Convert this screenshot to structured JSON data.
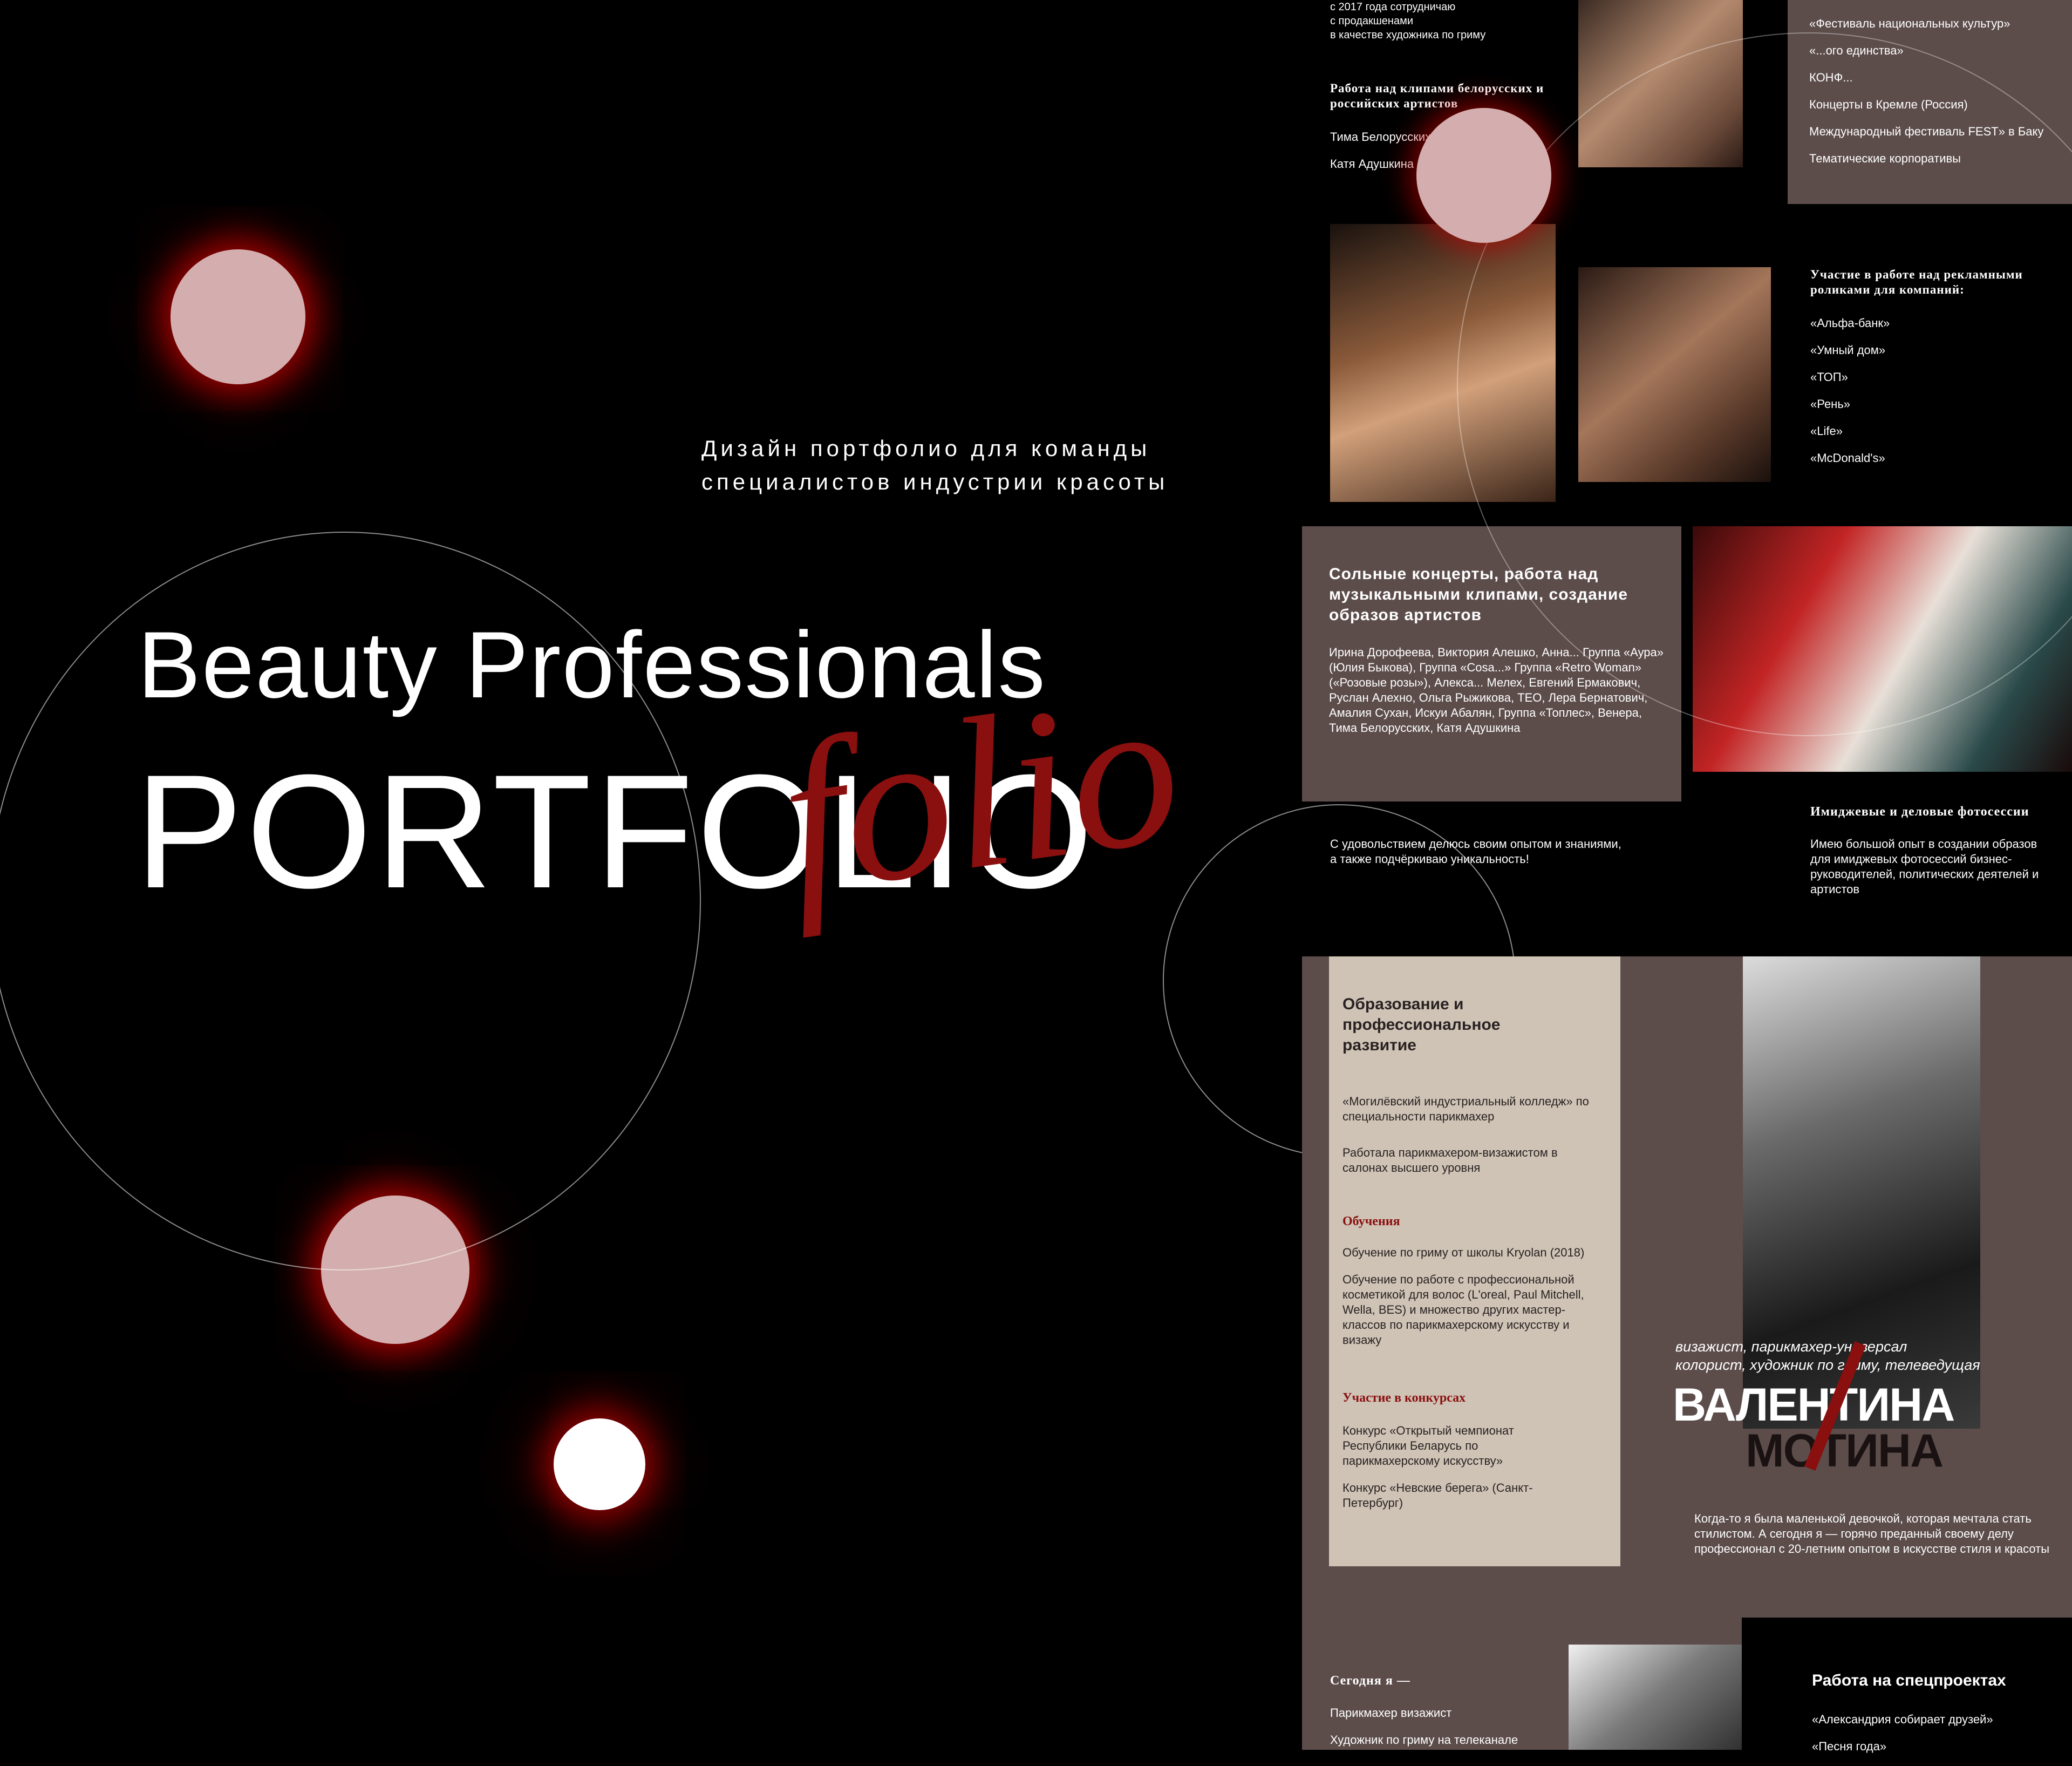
{
  "hero": {
    "subtitle_line1": "Дизайн портфолио для команды",
    "subtitle_line2": "специалистов индустрии красоты",
    "title_line1": "Beauty Professionals",
    "title_line2": "PORTFOLIO",
    "script_overlay": "folio"
  },
  "top_left": {
    "intro_lines": [
      "с 2017 года сотрудничаю",
      "с продакшенами",
      "в качестве художника по гриму"
    ],
    "clips_heading": "Работа над клипами белорусских и российских артистов",
    "clips_items": [
      "Тима Белорусских",
      "Катя Адушкина"
    ]
  },
  "top_right": {
    "events_items": [
      "«Фестиваль национальных культур»",
      "«...ого единства»",
      "КОНФ...",
      "Концерты в Кремле (Россия)",
      "Международный фестиваль FEST» в Баку",
      "Тематические корпоративы"
    ]
  },
  "ads": {
    "heading": "Участие в работе над рекламными роликами для компаний:",
    "items": [
      "«Альфа-банк»",
      "«Умный дом»",
      "«ТОП»",
      "«Рень»",
      "«Life»",
      "«McDonald's»"
    ]
  },
  "concerts": {
    "heading": "Сольные концерты, работа над музыкальными клипами, создание образов артистов",
    "body": "Ирина Дорофеева, Виктория Алешко, Анна... Группа «Аура» (Юлия Быкова), Группа «Cosa...» Группа «Retro Woman» («Розовые розы»), Алекса... Мелех, Евгений Ермакович, Руслан Алехно, Ольга Рыжикова, TEO, Лера Бернатович, Амалия Сухан, Искуи Абалян, Группа «Топлес», Венера, Тима Белорусских, Катя Адушкина"
  },
  "share": {
    "text_line1": "С удовольствием делюсь своим опытом и знаниями,",
    "text_line2": "а также подчёркиваю уникальность!"
  },
  "image_sessions": {
    "heading": "Имиджевые и деловые фотосессии",
    "body": "Имею большой опыт в создании образов для имиджевых фотосессий бизнес-руководителей, политических деятелей и артистов"
  },
  "education": {
    "heading": "Образование и профессиональное развитие",
    "college": "«Могилёвский индустриальный колледж» по специальности парикмахер",
    "work": "Работала парикмахером-визажистом в салонах высшего уровня",
    "training_heading": "Обучения",
    "training_items": [
      "Обучение по гриму от школы Kryolan (2018)",
      "Обучение по работе с профессиональной косметикой для волос (L'oreal, Paul Mitchell, Wella, BES) и множество других мастер-классов по парикмахерскому искусству и визажу"
    ],
    "contests_heading": "Участие в конкурсах",
    "contests_items": [
      "Конкурс «Открытый чемпионат Республики Беларусь по парикмахерскому искусству»",
      "Конкурс «Невские берега» (Санкт-Петербург)"
    ]
  },
  "profile": {
    "roles_line1": "визажист, парикмахер-универсал",
    "roles_line2": "колорист, художник по гриму, телеведущая",
    "name_first": "ВАЛЕНТИНА",
    "name_last": "МОТИНА",
    "bio": "Когда-то я была маленькой девочкой, которая мечтала стать стилистом. А сегодня я — горячо преданный своему делу профессионал с 20-летним опытом в искусстве стиля и красоты"
  },
  "today": {
    "heading": "Сегодня я —",
    "items": [
      "Парикмахер визажист",
      "Художник по гриму на телеканале"
    ]
  },
  "special": {
    "heading": "Работа на спецпроектах",
    "items": [
      "«Александрия собирает друзей»",
      "«Песня года»"
    ]
  },
  "colors": {
    "accent_red": "#8a0f0f",
    "panel_brown": "#5c4d4b",
    "panel_beige": "#cec3b5",
    "dot_pink": "#d4aeae"
  }
}
